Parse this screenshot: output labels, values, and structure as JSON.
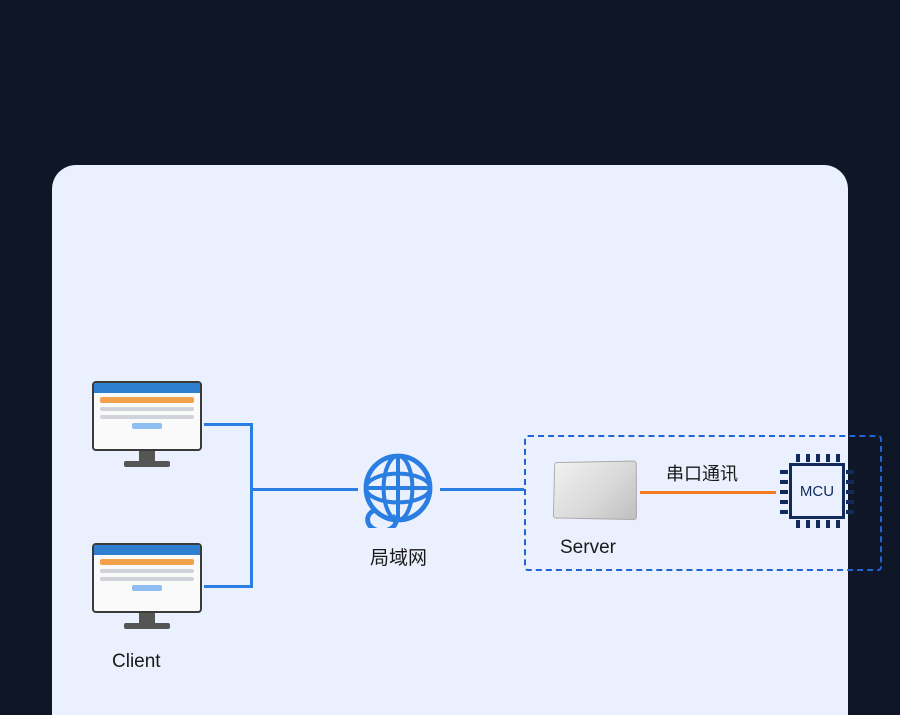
{
  "nodes": {
    "client": {
      "label": "Client"
    },
    "lan": {
      "label": "局域网"
    },
    "server": {
      "label": "Server"
    },
    "mcu": {
      "label": "MCU"
    }
  },
  "links": {
    "serial": {
      "label": "串口通讯"
    }
  },
  "colors": {
    "background": "#0e1628",
    "card": "#eaf0fd",
    "line": "#2a7de1",
    "serial": "#f47a1f",
    "dashed": "#2064d6",
    "mcu_stroke": "#102a5c"
  }
}
